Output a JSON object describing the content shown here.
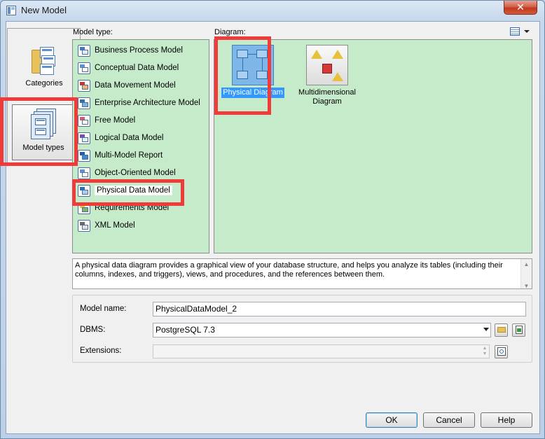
{
  "window": {
    "title": "New Model",
    "close_glyph": "✕"
  },
  "sidebar": {
    "items": [
      {
        "label": "Categories",
        "icon": "categories-folder-icon",
        "selected": false
      },
      {
        "label": "Model types",
        "icon": "model-types-icon",
        "selected": true
      }
    ]
  },
  "model_type": {
    "label": "Model type:",
    "items": [
      {
        "label": "Business Process Model",
        "icon": "business-process-model-icon"
      },
      {
        "label": "Conceptual Data Model",
        "icon": "conceptual-data-model-icon"
      },
      {
        "label": "Data Movement Model",
        "icon": "data-movement-model-icon"
      },
      {
        "label": "Enterprise Architecture Model",
        "icon": "enterprise-architecture-model-icon"
      },
      {
        "label": "Free Model",
        "icon": "free-model-icon"
      },
      {
        "label": "Logical Data Model",
        "icon": "logical-data-model-icon"
      },
      {
        "label": "Multi-Model Report",
        "icon": "multi-model-report-icon"
      },
      {
        "label": "Object-Oriented Model",
        "icon": "object-oriented-model-icon"
      },
      {
        "label": "Physical Data Model",
        "icon": "physical-data-model-icon",
        "selected": true
      },
      {
        "label": "Requirements Model",
        "icon": "requirements-model-icon"
      },
      {
        "label": "XML Model",
        "icon": "xml-model-icon"
      }
    ]
  },
  "diagram": {
    "label": "Diagram:",
    "view_icon": "view-options-icon",
    "items": [
      {
        "label": "Physical Diagram",
        "icon": "physical-diagram-icon",
        "selected": true
      },
      {
        "label": "Multidimensional Diagram",
        "icon": "multidimensional-diagram-icon",
        "selected": false
      }
    ]
  },
  "description": "A physical data diagram provides a graphical view of your database structure, and helps you analyze its tables (including their columns, indexes, and triggers), views, and procedures, and the references between them.",
  "form": {
    "model_name": {
      "label": "Model name:",
      "value": "PhysicalDataModel_2"
    },
    "dbms": {
      "label": "DBMS:",
      "value": "PostgreSQL 7.3"
    },
    "extensions": {
      "label": "Extensions:",
      "value": ""
    }
  },
  "buttons": {
    "ok": "OK",
    "cancel": "Cancel",
    "help": "Help"
  },
  "colors": {
    "panel_bg": "#c6ebcb",
    "highlight": "#f03b3b",
    "selection": "#3399ff"
  }
}
